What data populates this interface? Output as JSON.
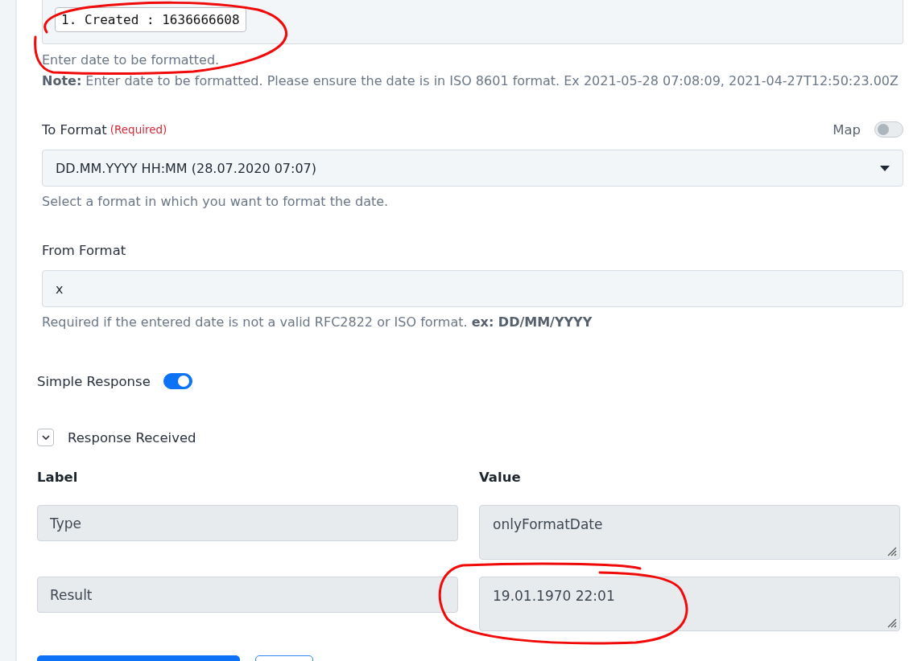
{
  "date_field": {
    "chip": "1. Created : 1636666608",
    "help": "Enter date to be formatted.",
    "note": "**Note:** Enter date to be formatted. Please ensure the date is in ISO 8601 format. Ex 2021-05-28 07:08:09, 2021-04-27T12:50:23.00Z"
  },
  "to_format": {
    "label": "To Format",
    "required_text": "(Required)",
    "map_label": "Map",
    "map_on": false,
    "value": "DD.MM.YYYY HH:MM (28.07.2020 07:07)",
    "help": "Select a format in which you want to format the date."
  },
  "from_format": {
    "label": "From Format",
    "value": "x",
    "help": "Required if the entered date is not a valid RFC2822 or ISO format. **ex: DD/MM/YYYY**"
  },
  "simple_response": {
    "label": "Simple Response",
    "on": true
  },
  "response": {
    "title": "Response Received",
    "expanded": true,
    "columns": [
      "Label",
      "Value"
    ],
    "rows": [
      {
        "label": "Type",
        "value": "onlyFormatDate"
      },
      {
        "label": "Result",
        "value": "19.01.1970 22:01"
      }
    ]
  },
  "footer_buttons": [
    {
      "kind": "primary"
    },
    {
      "kind": "outline"
    }
  ]
}
